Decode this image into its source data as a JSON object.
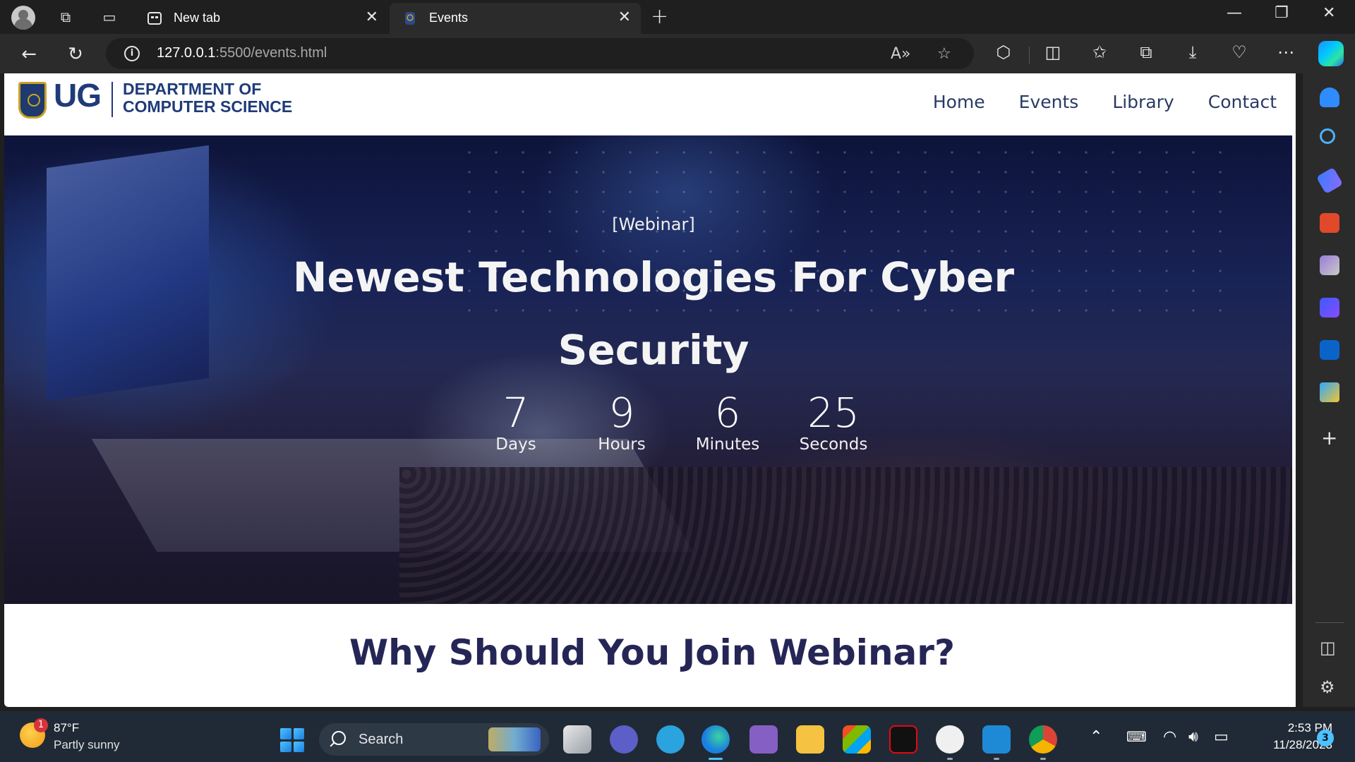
{
  "browser": {
    "tabs": [
      {
        "label": "New tab",
        "active": false
      },
      {
        "label": "Events",
        "active": true
      }
    ],
    "url_host": "127.0.0.1",
    "url_path": ":5500/events.html"
  },
  "site": {
    "logo_text": "UG",
    "dept_line1": "DEPARTMENT OF",
    "dept_line2": "COMPUTER SCIENCE",
    "nav": [
      {
        "label": "Home"
      },
      {
        "label": "Events"
      },
      {
        "label": "Library"
      },
      {
        "label": "Contact"
      }
    ]
  },
  "hero": {
    "eyebrow": "[Webinar]",
    "title": "Newest Technologies For Cyber Security",
    "countdown": [
      {
        "value": "7",
        "label": "Days"
      },
      {
        "value": "9",
        "label": "Hours"
      },
      {
        "value": "6",
        "label": "Minutes"
      },
      {
        "value": "25",
        "label": "Seconds"
      }
    ]
  },
  "section": {
    "title": "Why Should You Join Webinar?"
  },
  "taskbar": {
    "weather_temp": "87°F",
    "weather_desc": "Partly sunny",
    "weather_badge": "1",
    "search_label": "Search",
    "time": "2:53 PM",
    "date": "11/28/2023",
    "notification_count": "3"
  },
  "colors": {
    "nav_text": "#2a3a66",
    "brand_blue": "#1f3b7a",
    "section_title": "#252656"
  }
}
